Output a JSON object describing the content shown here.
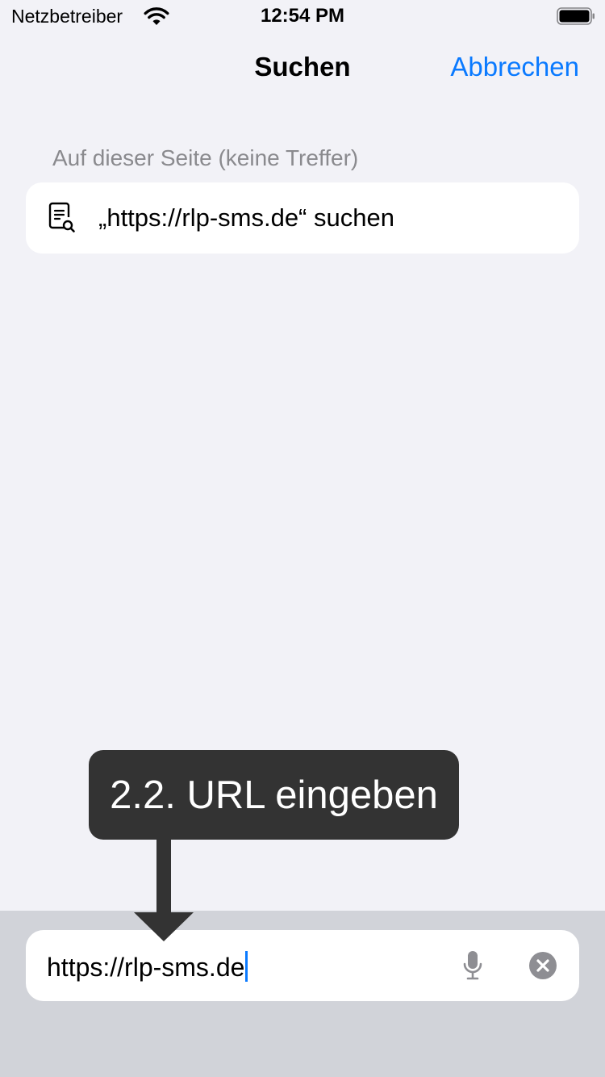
{
  "status_bar": {
    "carrier": "Netzbetreiber",
    "time": "12:54 PM",
    "wifi_icon": "wifi-icon",
    "battery_icon": "battery-icon"
  },
  "nav": {
    "title": "Suchen",
    "cancel_label": "Abbrechen",
    "accent_color": "#0a7aff"
  },
  "results": {
    "section_header": "Auf dieser Seite (keine Treffer)",
    "items": [
      {
        "icon": "doc-search-icon",
        "label": "„https://rlp-sms.de“ suchen"
      }
    ]
  },
  "search_field": {
    "value": "https://rlp-sms.de",
    "mic_icon": "mic-icon",
    "clear_icon": "clear-icon"
  },
  "callout": {
    "text": "2.2. URL eingeben"
  }
}
